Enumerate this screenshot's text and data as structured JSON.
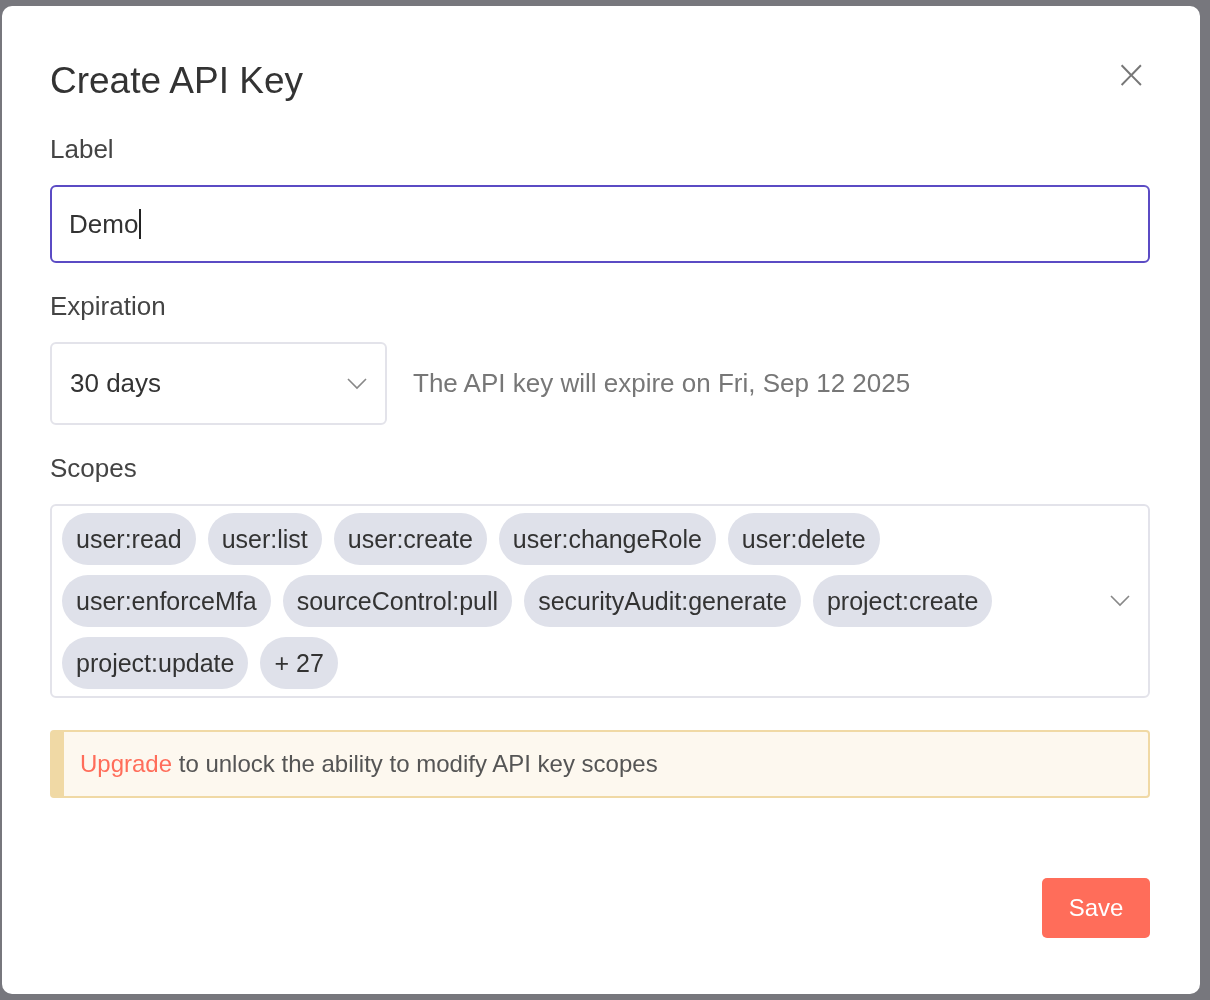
{
  "dialog": {
    "title": "Create API Key",
    "close_icon": "×"
  },
  "label_field": {
    "label": "Label",
    "value": "Demo",
    "focused": true
  },
  "expiration": {
    "label": "Expiration",
    "value": "30 days",
    "hint": "The API key will expire on Fri, Sep 12 2025"
  },
  "scopes": {
    "label": "Scopes",
    "tags": [
      "user:read",
      "user:list",
      "user:create",
      "user:changeRole",
      "user:delete",
      "user:enforceMfa",
      "sourceControl:pull",
      "securityAudit:generate",
      "project:create",
      "project:update",
      "+ 27"
    ]
  },
  "callout": {
    "link": "Upgrade",
    "text": " to unlock the ability to modify API key scopes"
  },
  "buttons": [
    {
      "label": "Save"
    }
  ]
}
